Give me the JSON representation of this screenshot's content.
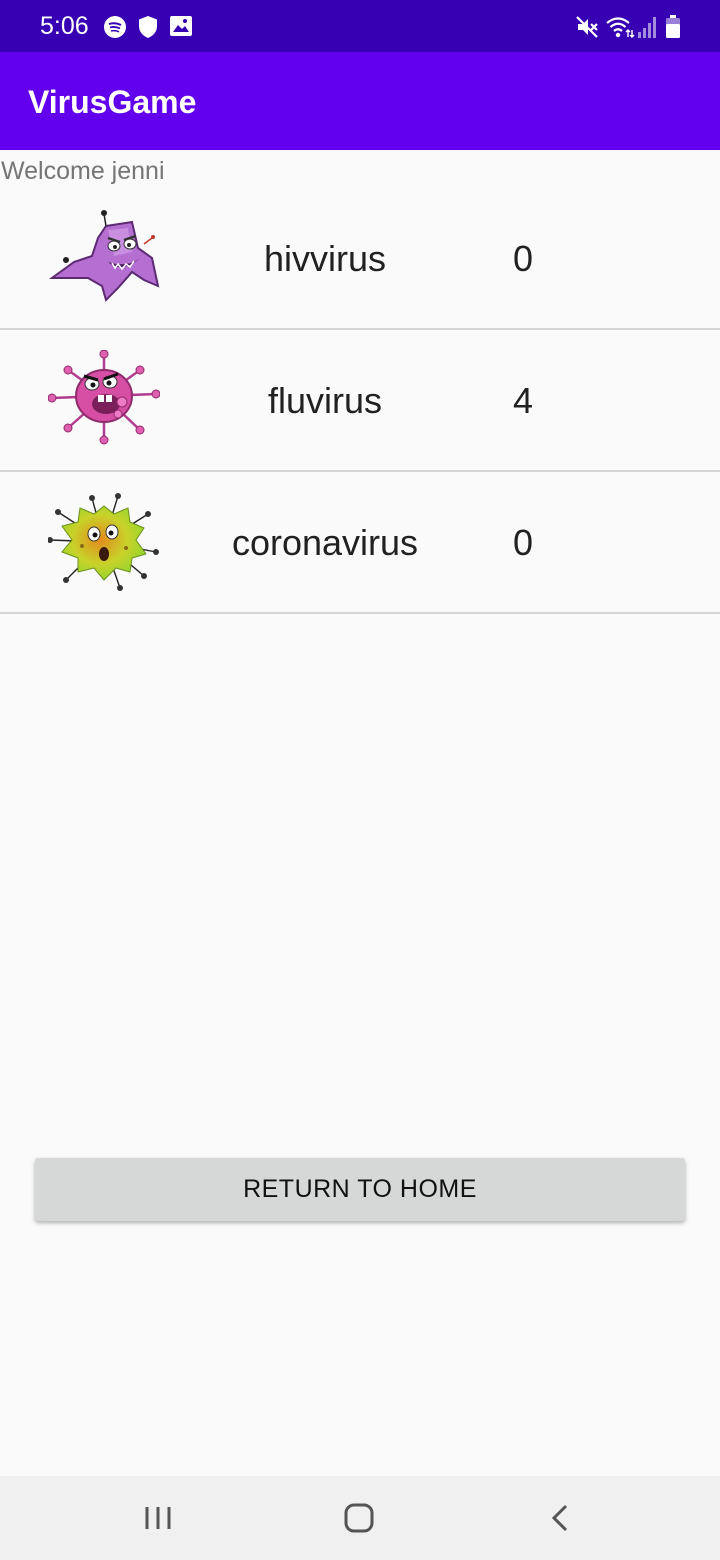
{
  "status_bar": {
    "time": "5:06",
    "icons_left": [
      "spotify-icon",
      "shield-icon",
      "gallery-icon"
    ],
    "icons_right": [
      "mute-icon",
      "wifi-icon",
      "signal-icon",
      "battery-icon"
    ]
  },
  "app_bar": {
    "title": "VirusGame"
  },
  "welcome_text": "Welcome jenni",
  "viruses": [
    {
      "name": "hivvirus",
      "score": "0",
      "icon": "purple-virus-icon"
    },
    {
      "name": "fluvirus",
      "score": "4",
      "icon": "pink-virus-icon"
    },
    {
      "name": "coronavirus",
      "score": "0",
      "icon": "green-virus-icon"
    }
  ],
  "home_button": {
    "label": "RETURN TO HOME"
  },
  "nav_bar": {
    "icons": [
      "recents-icon",
      "home-icon",
      "back-icon"
    ]
  },
  "colors": {
    "status_bar": "#3700b3",
    "app_bar": "#6200ee",
    "background": "#fafafa",
    "button": "#d6d7d7"
  }
}
